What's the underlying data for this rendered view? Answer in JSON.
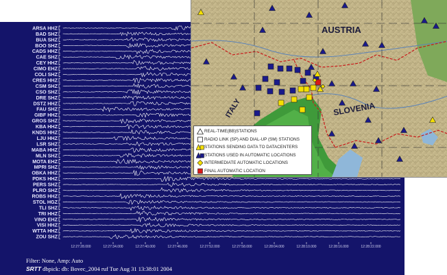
{
  "stations": [
    "ARSA HHZ",
    "BAD SHZ",
    "BUA SHZ",
    "BOO SHZ",
    "CADS HHZ",
    "CAE SHZ",
    "CEY HHZ",
    "CIMO EHZ",
    "COLI SHZ",
    "CRES HHZ",
    "CSM SHZ",
    "CSO SHZ",
    "DRE SHZ",
    "DSTZ HHZ",
    "FAU SHZ",
    "GIBF HHZ",
    "GROS SHZ",
    "KBA HHZ",
    "KNDS HHZ",
    "LJU HHZ",
    "LSR SHZ",
    "MABA HHZ",
    "MLN SHZ",
    "MOTA EHZ",
    "MPRI SHZ",
    "OBKA HHZ",
    "PDKS HHZ",
    "PERS SHZ",
    "PLRO SHZ",
    "ROBS HHZ",
    "STOL HGZ",
    "TLI SHZ",
    "TRI HHZ",
    "VINO EHZ",
    "VISI HHZ",
    "WTTA HHZ",
    "ZOU SHZ"
  ],
  "time_ticks": [
    "12:27:28.000",
    "12:27:34.000",
    "12:27:40.000",
    "12:27:46.000",
    "12:27:52.000",
    "12:27:58.000",
    "12:28:04.000",
    "12:28:10.000",
    "12:28:16.000",
    "12:28:22.000"
  ],
  "footer": {
    "filter": "Filter: None, Amp: Auto",
    "brand": "SRTT",
    "info": "dbpick: db: Bovec_2004 ruf Tue Aug 31 13:38:01 2004"
  },
  "map": {
    "labels": {
      "austria": "AUSTRIA",
      "slovenia": "SLOVENIA",
      "italy": "ITALY"
    }
  },
  "legend": [
    {
      "symbol": "open-triangle-icon",
      "label": "REAL-TIME(BB)STATIONS"
    },
    {
      "symbol": "open-square-icon",
      "label": "RADIO LINK (SP) AND DIAL-UP (SM) STATIONS"
    },
    {
      "symbol": "yellow-triangle-square-icon",
      "label": "STATIONS SENDING DATA TO DATACENTERS"
    },
    {
      "symbol": "blue-triangle-square-icon",
      "label": "STATIONS USED IN AUTOMATIC LOCATIONS"
    },
    {
      "symbol": "yellow-diamond-icon",
      "label": "INTERMEDIATE AUTOMATIC LOCATIONS"
    },
    {
      "symbol": "red-square-icon",
      "label": "FINAL AUTOMATIC LOCATION"
    }
  ],
  "colors": {
    "panel": "#14146a",
    "trace": "#ffffff",
    "station_blue": "#1a1a8a",
    "station_yellow": "#f5e000",
    "final_location": "#d81818"
  }
}
